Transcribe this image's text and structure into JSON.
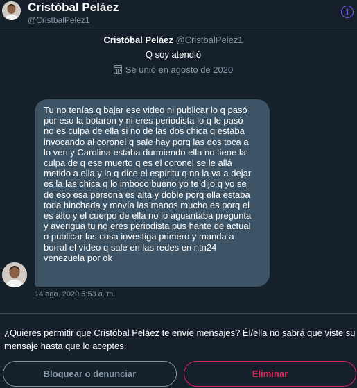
{
  "header": {
    "name": "Cristóbal Peláez",
    "handle": "@CristbalPelez1"
  },
  "profile": {
    "name": "Cristóbal Peláez",
    "handle": "@CristbalPelez1",
    "bio": "Q soy atendió",
    "joined": "Se unió en agosto de 2020"
  },
  "message": {
    "lines": [
      "Tu no tenías q bajar ese video ni publicar lo q pasó",
      "por eso la botaron y ni eres periodista lo q le pasó",
      "no es culpa de ella si no de las dos chica q estaba",
      "invocando al coronel q sale hay porq las dos toca a",
      "lo ven y Carolina estaba durmiendo ella no tiene la",
      "culpa de q ese muerto q es el coronel se le allá",
      "metido a ella y lo q dice el espíritu q no la va a dejar",
      "es la las chica q lo imboco bueno yo te dijo q yo se",
      "de eso esa persona es alta y doble porq ella estaba",
      "toda hinchada y movía las manos mucho es porq el",
      "es alto y el cuerpo de ella no lo aguantaba pregunta",
      "y averigua tu no eres periodista pus hante de actual",
      "o publicar las cosa investiga primero y manda a",
      "borral el vídeo q sale en las redes  en ntn24",
      "venezuela por ok"
    ],
    "timestamp": "14 ago. 2020 5:53 a. m."
  },
  "request": {
    "text": "¿Quieres permitir que Cristóbal Peláez te envíe mensajes? Él/ella no sabrá que viste su mensaje hasta que lo aceptes.",
    "block_label": "Bloquear o denunciar",
    "delete_label": "Eliminar"
  },
  "icons": {
    "info": "info-icon",
    "calendar": "calendar-icon"
  },
  "colors": {
    "background": "#15202b",
    "bubble": "#3d5466",
    "muted": "#8899a6",
    "accent": "#7856ff",
    "danger": "#e0245e"
  }
}
